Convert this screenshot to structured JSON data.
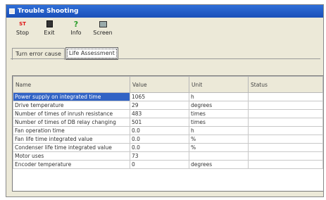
{
  "window": {
    "title": "Trouble Shooting"
  },
  "toolbar": {
    "items": [
      {
        "label": "Stop",
        "icon": "stop-icon"
      },
      {
        "label": "Exit",
        "icon": "exit-icon"
      },
      {
        "label": "Info",
        "icon": "info-icon"
      },
      {
        "label": "Screen",
        "icon": "screen-icon"
      }
    ]
  },
  "tabs": [
    {
      "label": "Turn error cause",
      "active": false
    },
    {
      "label": "Life Assessment",
      "active": true
    }
  ],
  "table": {
    "headers": [
      "Name",
      "Value",
      "Unit",
      "Status"
    ],
    "rows": [
      {
        "name": "Power supply on integrated time",
        "value": "1065",
        "unit": "h",
        "status": ""
      },
      {
        "name": "Drive temperature",
        "value": "29",
        "unit": "degrees",
        "status": ""
      },
      {
        "name": "Number of times of inrush resistance",
        "value": "483",
        "unit": "times",
        "status": ""
      },
      {
        "name": "Number of times of DB relay changing",
        "value": "501",
        "unit": "times",
        "status": ""
      },
      {
        "name": "Fan operation time",
        "value": "0.0",
        "unit": "h",
        "status": ""
      },
      {
        "name": "Fan life time integrated value",
        "value": "0.0",
        "unit": "%",
        "status": ""
      },
      {
        "name": "Condenser life time integrated value",
        "value": "0.0",
        "unit": "%",
        "status": ""
      },
      {
        "name": "Motor uses",
        "value": "73",
        "unit": "",
        "status": ""
      },
      {
        "name": "Encoder temperature",
        "value": "0",
        "unit": "degrees",
        "status": ""
      }
    ]
  },
  "colors": {
    "titlebar": "#1a4fb8",
    "selection": "#3163c5",
    "window_bg": "#ece9d8"
  }
}
